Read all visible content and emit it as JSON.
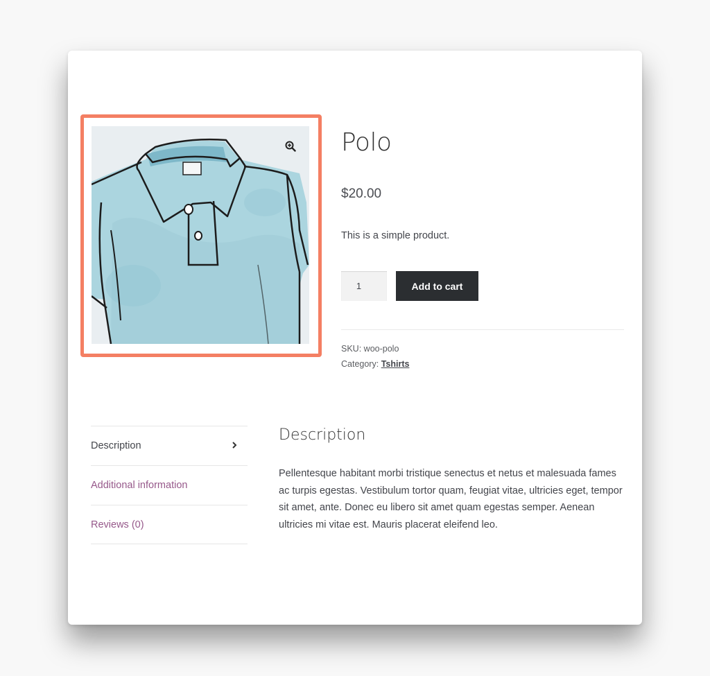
{
  "product": {
    "title": "Polo",
    "price": "$20.00",
    "short_description": "This is a simple product.",
    "quantity": "1",
    "add_to_cart_label": "Add to cart",
    "sku_label": "SKU:",
    "sku": "woo-polo",
    "category_label": "Category:",
    "category": "Tshirts",
    "image_icon": "zoom-in-icon"
  },
  "tabs": [
    {
      "label": "Description",
      "active": true
    },
    {
      "label": "Additional information",
      "active": false
    },
    {
      "label": "Reviews (0)",
      "active": false
    }
  ],
  "description": {
    "heading": "Description",
    "body": "Pellentesque habitant morbi tristique senectus et netus et malesuada fames ac turpis egestas. Vestibulum tortor quam, feugiat vitae, ultricies eget, tempor sit amet, ante. Donec eu libero sit amet quam egestas semper. Aenean ultricies mi vitae est. Mauris placerat eleifend leo."
  },
  "colors": {
    "highlight": "#f47f63",
    "button": "#2b2e31",
    "link": "#96588a",
    "shirt": "#a8d3dd"
  }
}
